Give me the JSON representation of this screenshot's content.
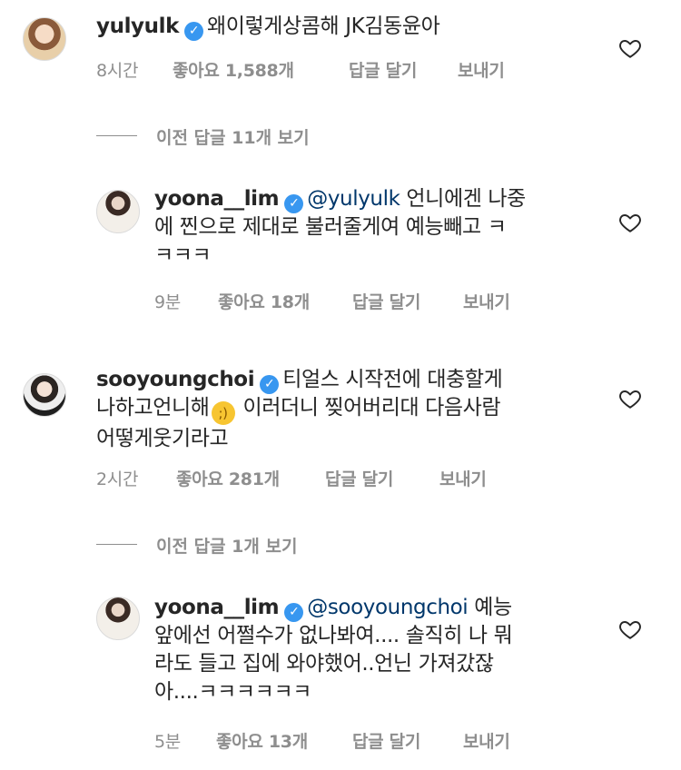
{
  "comments": [
    {
      "username": "yulyulk",
      "text": "왜이렇게상콤해 JK김동윤아",
      "time": "8시간",
      "likes": "좋아요 1,588개",
      "reply_label": "답글 달기",
      "send_label": "보내기"
    },
    {
      "view_replies": "이전 답글 11개 보기"
    },
    {
      "username": "yoona__lim",
      "mention": "@yulyulk",
      "text_line1": " 언니에겐 나중",
      "text_line2": "에 찐으로 제대로 불러줄게여 예능빼고 ㅋ",
      "text_line3": "ㅋㅋㅋ",
      "time": "9분",
      "likes": "좋아요 18개",
      "reply_label": "답글 달기",
      "send_label": "보내기"
    },
    {
      "username": "sooyoungchoi",
      "text_line1": "티얼스 시작전에 대충할게",
      "text_line2a": "나하고언니해",
      "emoji": "😉",
      "text_line2b": " 이러더니 찢어버리대 다음사람",
      "text_line3": "어떻게웃기라고",
      "time": "2시간",
      "likes": "좋아요 281개",
      "reply_label": "답글 달기",
      "send_label": "보내기"
    },
    {
      "view_replies": "이전 답글 1개 보기"
    },
    {
      "username": "yoona__lim",
      "mention": "@sooyoungchoi",
      "text_line1": "  예능",
      "text_line2": "앞에선 어쩔수가 없나봐여.... 솔직히 나 뭐",
      "text_line3": "라도 들고 집에 와야했어..언닌 가져갔잖",
      "text_line4": "아....ㅋㅋㅋㅋㅋㅋ",
      "time": "5분",
      "likes": "좋아요 13개",
      "reply_label": "답글 달기",
      "send_label": "보내기"
    }
  ],
  "icons": {
    "verified": "verified-badge-icon",
    "heart": "heart-outline-icon"
  },
  "colors": {
    "text": "#262626",
    "secondary": "#8e8e8e",
    "mention": "#00376b",
    "verified": "#3897f0"
  }
}
